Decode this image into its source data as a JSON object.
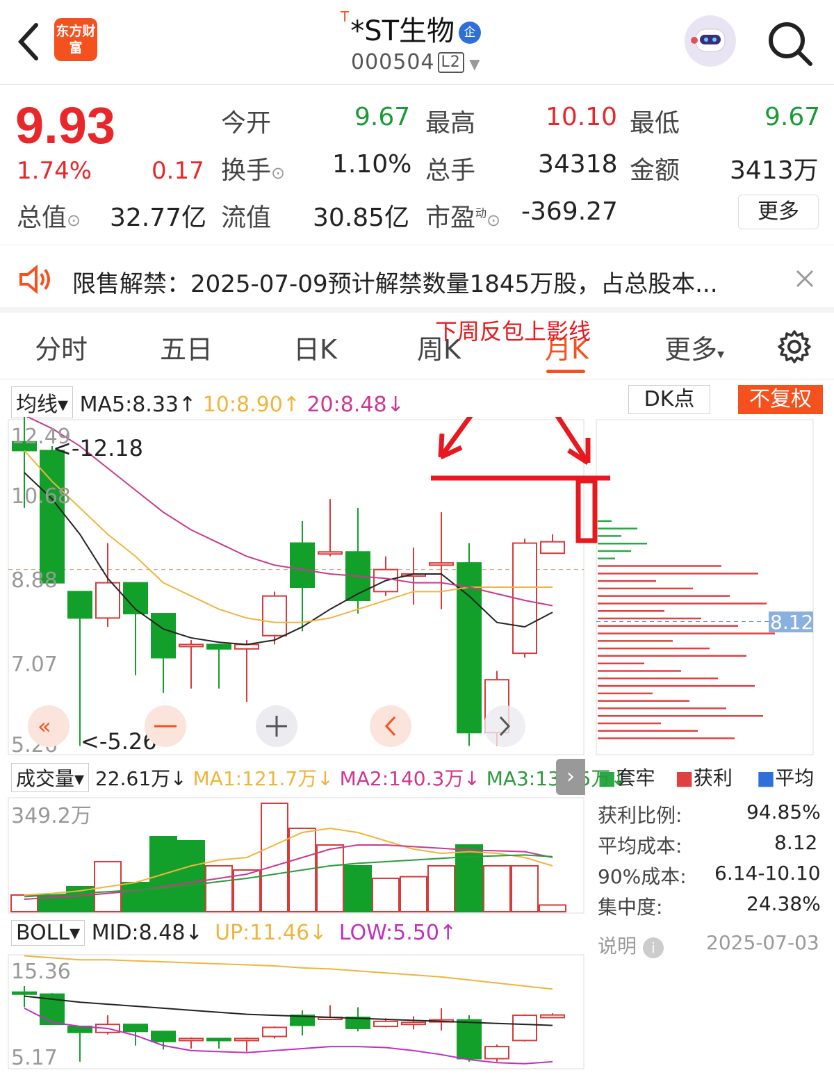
{
  "header": {
    "logo_text": "东方财富",
    "title_prefix": "T",
    "title": "*ST生物",
    "badge": "企",
    "code": "000504",
    "level": "L2"
  },
  "quote": {
    "price": "9.93",
    "change_pct": "1.74%",
    "change": "0.17",
    "rows": [
      {
        "l1": "今开",
        "v1": "9.67",
        "l2": "最高",
        "v2": "10.10",
        "l3": "最低",
        "v3": "9.67"
      },
      {
        "l1": "换手",
        "v1": "1.10%",
        "l2": "总手",
        "v2": "34318",
        "l3": "金额",
        "v3": "3413万"
      },
      {
        "l0": "总值",
        "v0": "32.77亿",
        "l1": "流值",
        "v1": "30.85亿",
        "l2": "市盈",
        "v2": "-369.27"
      }
    ],
    "pe_sup": "动",
    "more": "更多"
  },
  "notice": {
    "text": "限售解禁：2025-07-09预计解禁数量1845万股，占总股本..."
  },
  "tabs": [
    "分时",
    "五日",
    "日K",
    "周K",
    "月K",
    "更多"
  ],
  "annotation": "下周反包上影线",
  "ma": {
    "sel": "均线",
    "ma5": "MA5:8.33↑",
    "ma10": "10:8.90↑",
    "ma20": "20:8.48↓"
  },
  "dk": "DK点",
  "fq": "不复权",
  "kline": {
    "axis": [
      "12.49",
      "10.68",
      "8.88",
      "7.07",
      "5.26"
    ],
    "hi_label": "<-12.18",
    "lo_label": "<-5.26",
    "chip_avg": "8.12",
    "candles": [
      [
        12.2,
        12.0,
        12.8,
        10.7
      ],
      [
        12.0,
        9.0,
        12.1,
        9.0
      ],
      [
        8.8,
        8.2,
        8.8,
        5.3
      ],
      [
        8.2,
        9.0,
        9.9,
        8.0
      ],
      [
        9.0,
        8.3,
        9.0,
        6.9
      ],
      [
        8.3,
        7.3,
        8.3,
        6.5
      ],
      [
        7.6,
        7.6,
        7.7,
        6.6
      ],
      [
        7.6,
        7.5,
        7.6,
        6.6
      ],
      [
        7.5,
        7.6,
        7.7,
        6.3
      ],
      [
        7.8,
        8.7,
        8.8,
        7.6
      ],
      [
        9.9,
        8.9,
        10.4,
        7.9
      ],
      [
        9.7,
        9.7,
        10.9,
        9.6
      ],
      [
        9.7,
        8.6,
        10.7,
        8.3
      ],
      [
        8.8,
        9.3,
        9.6,
        8.7
      ],
      [
        9.2,
        9.2,
        9.8,
        8.5
      ],
      [
        9.4,
        9.45,
        10.6,
        8.4
      ],
      [
        9.45,
        5.6,
        9.9,
        5.3
      ],
      [
        5.6,
        6.8,
        7.0,
        5.3
      ],
      [
        7.4,
        9.9,
        10.0,
        7.3
      ],
      [
        9.67,
        9.93,
        10.1,
        9.67
      ]
    ],
    "ma5": [
      11.5,
      10.9,
      10.1,
      9.1,
      8.4,
      7.95,
      7.75,
      7.65,
      7.6,
      7.7,
      8.0,
      8.4,
      8.75,
      9.05,
      9.2,
      9.2,
      8.7,
      8.1,
      8.0,
      8.33
    ],
    "ma10": [
      12.0,
      11.3,
      10.7,
      10.1,
      9.6,
      9.0,
      8.7,
      8.4,
      8.2,
      8.1,
      8.1,
      8.2,
      8.4,
      8.6,
      8.8,
      8.8,
      8.9,
      8.9,
      8.9,
      8.9
    ],
    "ma20": [
      12.8,
      12.5,
      12.1,
      11.6,
      11.1,
      10.6,
      10.2,
      9.9,
      9.6,
      9.4,
      9.3,
      9.2,
      9.15,
      9.1,
      9.0,
      9.0,
      8.9,
      8.75,
      8.6,
      8.48
    ]
  },
  "chip": {
    "legend": [
      "套牢",
      "获利",
      "平均"
    ],
    "rows": [
      {
        "k": "获利比例:",
        "v": "94.85%"
      },
      {
        "k": "平均成本:",
        "v": "8.12"
      },
      {
        "k": "90%成本:",
        "v": "6.14-10.10"
      },
      {
        "k": "集中度:",
        "v": "24.38%"
      }
    ],
    "note": "说明",
    "date": "2025-07-03"
  },
  "volume": {
    "sel": "成交量",
    "v": "22.61万↓",
    "ma1": "MA1:121.7万↓",
    "ma2": "MA2:140.3万↓",
    "ma3": "MA3:139.5万↓",
    "axis_top": "349.2万",
    "bars": [
      20,
      20,
      30,
      60,
      35,
      90,
      85,
      55,
      50,
      130,
      100,
      80,
      55,
      40,
      42,
      55,
      80,
      55,
      55,
      8
    ],
    "ups": [
      1,
      0,
      0,
      1,
      0,
      0,
      0,
      1,
      1,
      1,
      1,
      1,
      0,
      1,
      1,
      1,
      0,
      1,
      1,
      1
    ]
  },
  "boll": {
    "sel": "BOLL",
    "mid": "MID:8.48↓",
    "up": "UP:11.46↓",
    "low": "LOW:5.50↑",
    "axis": [
      "15.36",
      "5.17"
    ]
  }
}
